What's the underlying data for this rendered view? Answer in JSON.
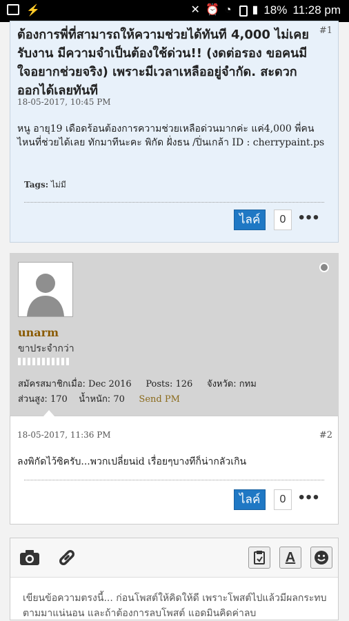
{
  "status_bar": {
    "battery": "18%",
    "time": "11:28 pm"
  },
  "post1": {
    "number": "#1",
    "title": "ต้องการพี่ที่สามารถให้ความช่วยได้ทันที 4,000 ไม่เคยรับงาน มีความจำเป็นต้องใช้ด่วน!! (งดต่อรอง ขอคนมีใจอยากช่วยจริง) เพราะมีเวลาเหลืออยู่จำกัด. สะดวกออกได้เลยทันที",
    "date": "18-05-2017, 10:45 PM",
    "body": "หนู อายุ19 เดือดร้อนต้องการความช่วยเหลือด่วนมากค่ะ แค่4,000 พี่คนไหนที่ช่วยได้เลย ทักมาทีนะคะ พิกัด ฝั่งธน /ปิ่นเกล้า ID : cherrypaint.ps",
    "tags_label": "Tags:",
    "tags_value": "ไม่มี",
    "like_label": "ไลค์",
    "like_count": "0"
  },
  "user": {
    "name": "unarm",
    "title": "ขาประจำกว่า",
    "joined_label": "สมัครสมาชิกเมื่อ:",
    "joined_value": "Dec 2016",
    "posts_label": "Posts:",
    "posts_value": "126",
    "province_label": "จังหวัด:",
    "province_value": "กทม",
    "height_label": "ส่วนสูง:",
    "height_value": "170",
    "weight_label": "น้ำหนัก:",
    "weight_value": "70",
    "send_pm": "Send PM"
  },
  "post2": {
    "number": "#2",
    "date": "18-05-2017, 11:36 PM",
    "body": "ลงพิกัดไว้ซิครับ...พวกเปลี่ยนid เรื่อยๆบางทีก็น่ากลัวเกิน",
    "like_label": "ไลค์",
    "like_count": "0"
  },
  "editor": {
    "placeholder": "เขียนข้อความตรงนี้... ก่อนโพสต์ให้คิดให้ดี เพราะโพสต์ไปแล้วมีผลกระทบตามมาแน่นอน และถ้าต้องการลบโพสต์ แอดมินคิดค่าลบ",
    "icons": [
      "camera-icon",
      "link-icon",
      "clipboard-icon",
      "text-format-icon",
      "smiley-icon"
    ]
  }
}
